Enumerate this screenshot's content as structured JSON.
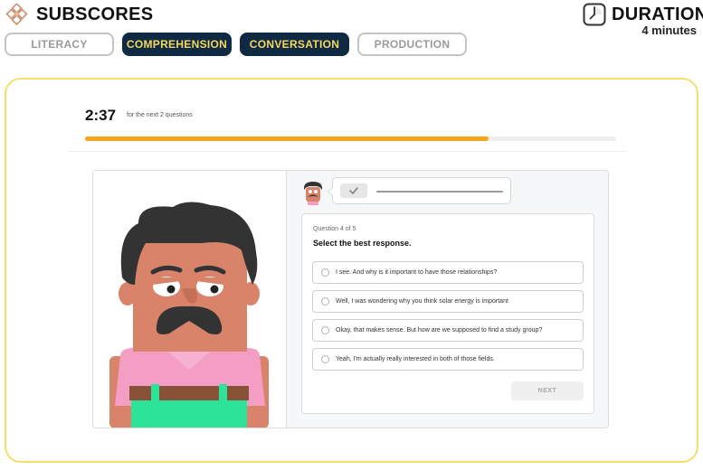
{
  "header": {
    "subscores_title": "SUBSCORES",
    "duration_title": "DURATION",
    "duration_value": "4 minutes",
    "subscores_icon": "diamond-grid-icon",
    "duration_icon": "clock-icon",
    "pills": [
      {
        "label": "LITERACY",
        "state": "outline"
      },
      {
        "label": "COMPREHENSION",
        "state": "active"
      },
      {
        "label": "CONVERSATION",
        "state": "active"
      },
      {
        "label": "PRODUCTION",
        "state": "outline"
      }
    ]
  },
  "test": {
    "timer": "2:37",
    "timer_note": "for the next 2 questions",
    "progress": 0.76,
    "play_icon": "checkmark-icon",
    "question_counter": "Question 4 of 5",
    "prompt": "Select the best response.",
    "options": [
      "I see. And why is it important to have those relationships?",
      "Well, I was wondering why you think solar energy is important",
      "Okay, that makes sense. But how are we supposed to find a study group?",
      "Yeah, I'm actually really interested in both of those fields."
    ],
    "next_label": "NEXT"
  },
  "colors": {
    "frame_border": "#f4df6b",
    "pill_active_bg": "#102a43",
    "pill_active_text": "#f5d85b",
    "progress_fill": "#f4a51c",
    "character_skin": "#d9846a",
    "character_hair": "#333333",
    "character_shirt": "#f59ec5",
    "character_overalls": "#2de39a"
  }
}
